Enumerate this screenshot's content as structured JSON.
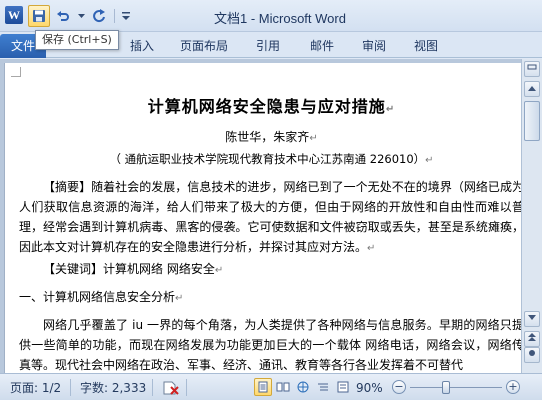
{
  "app": {
    "title": "文档1 - Microsoft Word",
    "icon_letter": "W"
  },
  "qat": {
    "save_icon": "save-icon",
    "undo_icon": "undo-icon",
    "redo_icon": "redo-icon",
    "customize_icon": "customize-qat-icon"
  },
  "tooltip": {
    "text": "保存 (Ctrl+S)"
  },
  "ribbon": {
    "file_tab": "文件",
    "tabs": [
      "插入",
      "页面布局",
      "引用",
      "邮件",
      "审阅",
      "视图"
    ]
  },
  "document": {
    "title": "计算机网络安全隐患与应对措施",
    "authors": "陈世华，朱家齐",
    "affiliation": "（ 通航运职业技术学院现代教育技术中心江苏南通 226010）",
    "abstract": "【摘要】随着社会的发展，信息技术的进步，网络已到了一个无处不在的境界（网络已成为人们获取信息资源的海洋，给人们带来了极大的方便，但由于网络的开放性和自由性而难以普理，经常会遇到计算机病毒、黑客的侵袭。它可使数据和文件被窃取或丢失，甚至是系统瘫痪，因此本文对计算机存在的安全隐患进行分析，并探讨其应对方法。",
    "keywords": "【关键词】计算机网络 网络安全",
    "section1": "一、计算机网络信息安全分析",
    "body1": "网络几乎覆盖了 iu 一界的每个角落，为人类提供了各种网络与信息服务。早期的网络只提供一些简单的功能，而现在网络发展为功能更加巨大的一个载体 网络电话，网络会议，网络传真等。现代社会中网络在政治、军事、经济、通讯、教育等各行各业发挥着不可替代",
    "paragraph_mark": "↵"
  },
  "status": {
    "page": "页面: 1/2",
    "words": "字数: 2,333",
    "zoom": "90%",
    "zoom_level_percent": 90
  },
  "colors": {
    "file_tab": "#2a5fae",
    "titlebar": "#dbe6f4",
    "accent_active": "#ffd86b"
  }
}
